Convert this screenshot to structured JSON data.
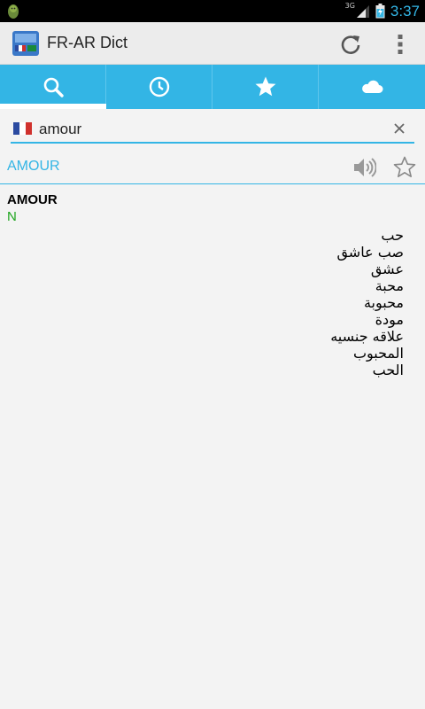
{
  "status_bar": {
    "network": "3G",
    "time": "3:37",
    "icons": [
      "android-app-icon",
      "signal-icon",
      "battery-icon"
    ]
  },
  "action_bar": {
    "title": "FR-AR Dict",
    "icons": [
      "app-logo-icon",
      "refresh-icon",
      "overflow-menu-icon"
    ]
  },
  "tabs": [
    {
      "icon": "search-icon",
      "active": true
    },
    {
      "icon": "clock-icon",
      "active": false
    },
    {
      "icon": "star-icon",
      "active": false
    },
    {
      "icon": "cloud-icon",
      "active": false
    }
  ],
  "search": {
    "language_flag": "france-flag-icon",
    "value": "amour",
    "clear_icon": "close-icon"
  },
  "result": {
    "headword": "AMOUR",
    "actions": [
      "speaker-icon",
      "star-outline-icon"
    ],
    "entry": {
      "word": "AMOUR",
      "part_of_speech": "N",
      "translations": [
        "حب",
        "صب عاشق",
        "عشق",
        "محبة",
        "محبوبة",
        "مودة",
        "علاقه جنسيه",
        "المحبوب",
        "الحب"
      ]
    }
  },
  "colors": {
    "accent": "#33b5e5",
    "pos_green": "#1ea51e",
    "background": "#f3f3f3"
  }
}
